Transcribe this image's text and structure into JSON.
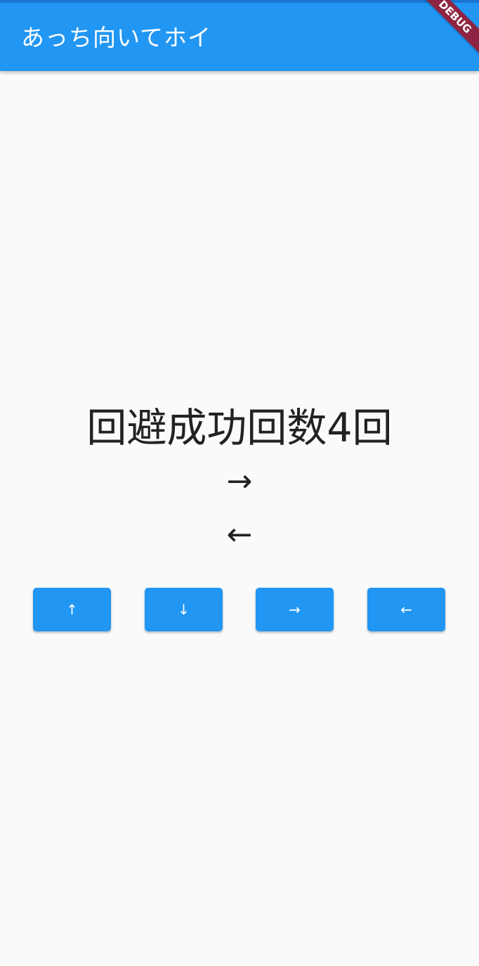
{
  "app_bar": {
    "title": "あっち向いてホイ",
    "debug_banner": "DEBUG"
  },
  "main": {
    "score_text": "回避成功回数4回",
    "direction_1": "→",
    "direction_2": "←"
  },
  "buttons": [
    {
      "label": "↑",
      "icon": "arrow-up-icon"
    },
    {
      "label": "↓",
      "icon": "arrow-down-icon"
    },
    {
      "label": "→",
      "icon": "arrow-right-icon"
    },
    {
      "label": "←",
      "icon": "arrow-left-icon"
    }
  ],
  "colors": {
    "primary": "#2196f3",
    "background": "#fafafa",
    "debug_banner": "#8e2442",
    "text": "#222222"
  }
}
